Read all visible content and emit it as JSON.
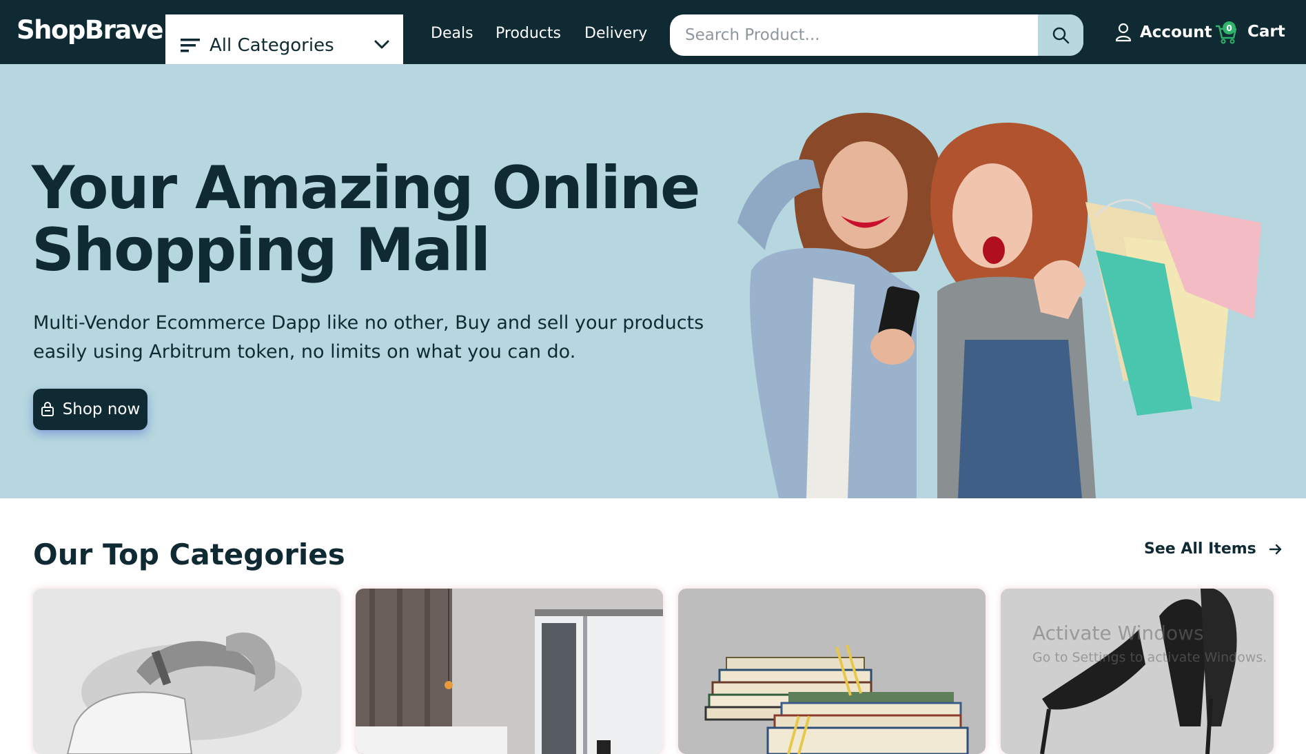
{
  "header": {
    "logo": "ShopBrave",
    "categories_label": "All Categories",
    "nav": [
      "Deals",
      "Products",
      "Delivery"
    ],
    "search_placeholder": "Search Product...",
    "account_label": "Account",
    "cart_label": "Cart",
    "cart_count": "0"
  },
  "hero": {
    "title": "Your Amazing Online Shopping Mall",
    "subtitle": "Multi-Vendor Ecommerce Dapp like no other, Buy and sell your products easily using Arbitrum token, no limits on what you can do.",
    "cta_label": "Shop now"
  },
  "categories": {
    "title": "Our Top Categories",
    "see_all_label": "See All Items"
  },
  "watermark": {
    "line1": "Activate Windows",
    "line2": "Go to Settings to activate Windows."
  },
  "colors": {
    "header_bg": "#102a33",
    "hero_bg": "#b6d7df",
    "text_dark": "#102a33",
    "badge": "#2db36a"
  }
}
